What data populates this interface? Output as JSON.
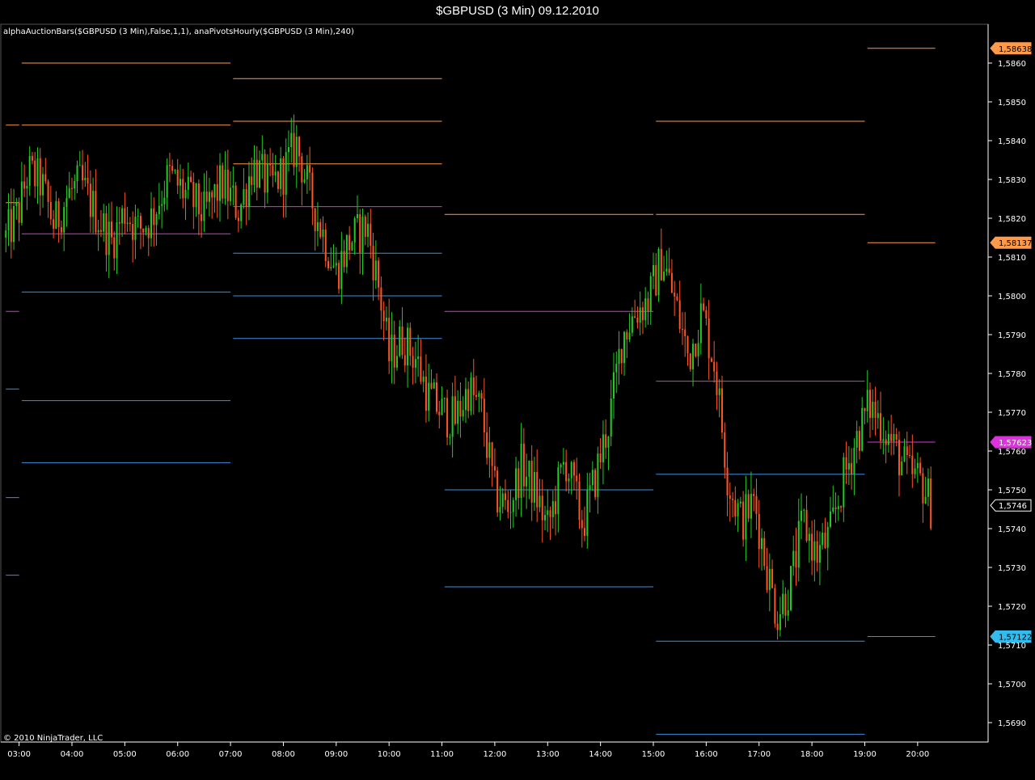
{
  "window": {
    "title": "$GBPUSD (3 Min)  09.12.2010",
    "indicator_label": "alphaAuctionBars($GBPUSD (3 Min),False,1,1), anaPivotsHourly($GBPUSD (3 Min),240)",
    "copyright": "© 2010 NinjaTrader, LLC"
  },
  "colors": {
    "background": "#000000",
    "up_bar": "#22cc22",
    "down_bar": "#ff5522",
    "resistance": "#ff9a4a",
    "pivot": "#dd33dd",
    "support": "#3a8fe0",
    "axis": "#ffffff"
  },
  "chart_data": {
    "type": "candlestick",
    "title": "$GBPUSD (3 Min)  09.12.2010",
    "x": [
      "03:00",
      "04:00",
      "05:00",
      "06:00",
      "07:00",
      "08:00",
      "09:00",
      "10:00",
      "11:00",
      "12:00",
      "13:00",
      "14:00",
      "15:00",
      "16:00",
      "17:00",
      "18:00",
      "19:00",
      "20:00"
    ],
    "xlim": [
      "02:42",
      "21:20"
    ],
    "ylim": [
      1.5685,
      1.587
    ],
    "y_ticks": [
      "1,5690",
      "1,5700",
      "1,5710",
      "1,5720",
      "1,5730",
      "1,5740",
      "1,5750",
      "1,5760",
      "1,5770",
      "1,5780",
      "1,5790",
      "1,5800",
      "1,5810",
      "1,5820",
      "1,5830",
      "1,5840",
      "1,5850",
      "1,5860"
    ],
    "bar_interval_minutes": 3,
    "price_path": [
      [
        "02:45",
        1.5815
      ],
      [
        "03:00",
        1.5822
      ],
      [
        "03:10",
        1.5832
      ],
      [
        "03:25",
        1.5829
      ],
      [
        "03:40",
        1.5818
      ],
      [
        "03:55",
        1.5826
      ],
      [
        "04:10",
        1.5829
      ],
      [
        "04:30",
        1.582
      ],
      [
        "04:45",
        1.5814
      ],
      [
        "05:00",
        1.5822
      ],
      [
        "05:15",
        1.5817
      ],
      [
        "05:30",
        1.582
      ],
      [
        "05:50",
        1.5831
      ],
      [
        "06:10",
        1.5826
      ],
      [
        "06:30",
        1.5821
      ],
      [
        "06:50",
        1.5829
      ],
      [
        "07:10",
        1.5822
      ],
      [
        "07:25",
        1.5834
      ],
      [
        "07:45",
        1.5828
      ],
      [
        "08:00",
        1.5832
      ],
      [
        "08:15",
        1.5839
      ],
      [
        "08:30",
        1.5826
      ],
      [
        "08:45",
        1.5816
      ],
      [
        "09:00",
        1.5806
      ],
      [
        "09:15",
        1.5814
      ],
      [
        "09:35",
        1.5818
      ],
      [
        "09:50",
        1.58
      ],
      [
        "10:00",
        1.5784
      ],
      [
        "10:15",
        1.5789
      ],
      [
        "10:30",
        1.5784
      ],
      [
        "10:45",
        1.5774
      ],
      [
        "11:00",
        1.577
      ],
      [
        "11:15",
        1.5768
      ],
      [
        "11:30",
        1.5776
      ],
      [
        "11:45",
        1.577
      ],
      [
        "12:00",
        1.5749
      ],
      [
        "12:15",
        1.5745
      ],
      [
        "12:30",
        1.5756
      ],
      [
        "12:45",
        1.575
      ],
      [
        "13:00",
        1.574
      ],
      [
        "13:20",
        1.5758
      ],
      [
        "13:40",
        1.5741
      ],
      [
        "13:55",
        1.5754
      ],
      [
        "14:10",
        1.5768
      ],
      [
        "14:25",
        1.579
      ],
      [
        "14:40",
        1.5796
      ],
      [
        "14:55",
        1.5799
      ],
      [
        "15:10",
        1.581
      ],
      [
        "15:25",
        1.5798
      ],
      [
        "15:40",
        1.5784
      ],
      [
        "15:55",
        1.5796
      ],
      [
        "16:10",
        1.5782
      ],
      [
        "16:25",
        1.5752
      ],
      [
        "16:40",
        1.5742
      ],
      [
        "16:55",
        1.5747
      ],
      [
        "17:05",
        1.5734
      ],
      [
        "17:20",
        1.5718
      ],
      [
        "17:35",
        1.5725
      ],
      [
        "17:50",
        1.5742
      ],
      [
        "18:05",
        1.5733
      ],
      [
        "18:20",
        1.5738
      ],
      [
        "18:35",
        1.5752
      ],
      [
        "18:50",
        1.5763
      ],
      [
        "19:05",
        1.5772
      ],
      [
        "19:20",
        1.5767
      ],
      [
        "19:35",
        1.576
      ],
      [
        "19:50",
        1.5754
      ],
      [
        "20:05",
        1.5752
      ],
      [
        "20:15",
        1.5746
      ]
    ],
    "current_price": "1,5746",
    "pivot_levels": [
      {
        "start": "02:45",
        "end": "03:00",
        "levels": [
          {
            "kind": "resistance",
            "value": 1.5844
          },
          {
            "kind": "resistance",
            "value": 1.5824
          },
          {
            "kind": "pivot",
            "value": 1.5796
          },
          {
            "kind": "support",
            "value": 1.5776
          },
          {
            "kind": "support",
            "value": 1.5748
          },
          {
            "kind": "support",
            "value": 1.5728
          }
        ]
      },
      {
        "start": "03:03",
        "end": "07:00",
        "levels": [
          {
            "kind": "resistance",
            "value": 1.586
          },
          {
            "kind": "resistance",
            "value": 1.5844
          },
          {
            "kind": "pivot",
            "value": 1.5816
          },
          {
            "kind": "support",
            "value": 1.5801
          },
          {
            "kind": "support",
            "value": 1.5773
          },
          {
            "kind": "support",
            "value": 1.5757
          }
        ]
      },
      {
        "start": "07:03",
        "end": "11:00",
        "levels": [
          {
            "kind": "resistance",
            "value": 1.5856
          },
          {
            "kind": "resistance",
            "value": 1.5845
          },
          {
            "kind": "resistance",
            "value": 1.5834
          },
          {
            "kind": "pivot",
            "value": 1.5823
          },
          {
            "kind": "support",
            "value": 1.5811
          },
          {
            "kind": "support",
            "value": 1.58
          },
          {
            "kind": "support",
            "value": 1.5789
          }
        ]
      },
      {
        "start": "11:03",
        "end": "15:00",
        "levels": [
          {
            "kind": "resistance",
            "value": 1.5821
          },
          {
            "kind": "pivot",
            "value": 1.5796
          },
          {
            "kind": "support",
            "value": 1.575
          },
          {
            "kind": "support",
            "value": 1.5725
          }
        ]
      },
      {
        "start": "15:03",
        "end": "19:00",
        "levels": [
          {
            "kind": "resistance",
            "value": 1.5845
          },
          {
            "kind": "resistance",
            "value": 1.5821
          },
          {
            "kind": "pivot",
            "value": 1.5778
          },
          {
            "kind": "support",
            "value": 1.5754
          },
          {
            "kind": "support",
            "value": 1.5711
          },
          {
            "kind": "support",
            "value": 1.5687
          }
        ]
      },
      {
        "start": "19:03",
        "end": "20:20",
        "levels": [
          {
            "kind": "resistance",
            "value": 1.58638
          },
          {
            "kind": "resistance",
            "value": 1.58137
          },
          {
            "kind": "pivot",
            "value": 1.57623
          },
          {
            "kind": "support",
            "value": 1.57122
          }
        ]
      }
    ],
    "price_badges": [
      {
        "label": "1,58638",
        "value": 1.58638,
        "kind": "resistance"
      },
      {
        "label": "1,58137",
        "value": 1.58137,
        "kind": "resistance"
      },
      {
        "label": "1,57623",
        "value": 1.57623,
        "kind": "pivot"
      },
      {
        "label": "1,5746",
        "value": 1.5746,
        "kind": "last"
      },
      {
        "label": "1,57122",
        "value": 1.57122,
        "kind": "support"
      }
    ]
  }
}
